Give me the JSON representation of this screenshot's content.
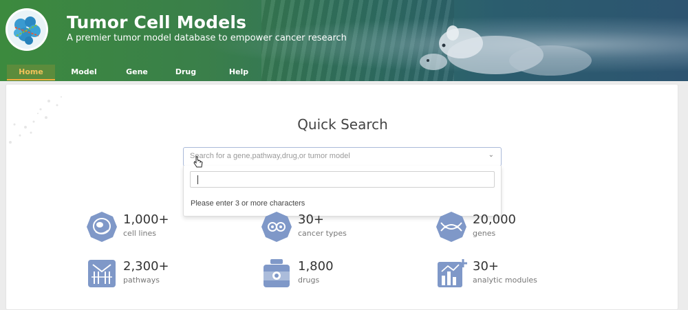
{
  "header": {
    "title": "Tumor Cell Models",
    "subtitle": "A premier tumor model database to empower cancer research"
  },
  "nav": {
    "items": [
      {
        "label": "Home",
        "active": true
      },
      {
        "label": "Model",
        "active": false
      },
      {
        "label": "Gene",
        "active": false
      },
      {
        "label": "Drug",
        "active": false
      },
      {
        "label": "Help",
        "active": false
      }
    ]
  },
  "search": {
    "title": "Quick Search",
    "placeholder": "Search for a gene,pathway,drug,or tumor model",
    "input_value": "",
    "hint": "Please enter 3 or more characters"
  },
  "stats": [
    {
      "value": "1,000+",
      "label": "cell lines",
      "icon": "cell-icon"
    },
    {
      "value": "30+",
      "label": "cancer types",
      "icon": "cancer-ribbon-icon"
    },
    {
      "value": "20,000",
      "label": "genes",
      "icon": "dna-icon"
    },
    {
      "value": "2,300+",
      "label": "pathways",
      "icon": "pathway-icon"
    },
    {
      "value": "1,800",
      "label": "drugs",
      "icon": "drug-icon"
    },
    {
      "value": "30+",
      "label": "analytic modules",
      "icon": "analytics-icon"
    }
  ],
  "colors": {
    "accent": "#f2a93b",
    "icon_fill": "#7f98c8",
    "header_green": "#3c8a3e"
  }
}
